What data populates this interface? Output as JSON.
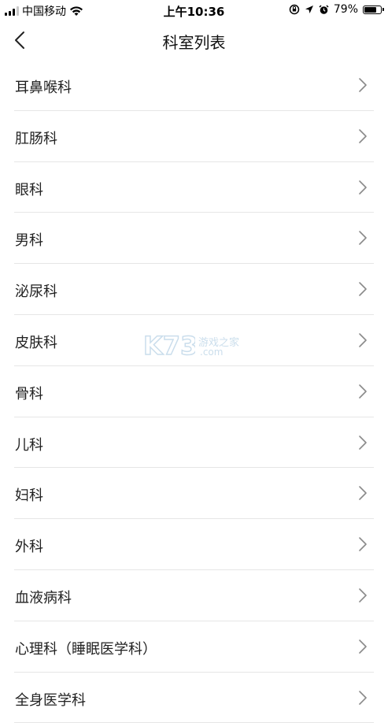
{
  "status_bar": {
    "carrier": "中国移动",
    "time": "上午10:36",
    "battery": "79%",
    "battery_level": 0.79,
    "icons": [
      "signal-icon",
      "wifi-icon",
      "lock-rotation-icon",
      "location-icon",
      "alarm-icon",
      "battery-icon"
    ]
  },
  "header": {
    "title": "科室列表",
    "back_icon": "back-arrow-icon"
  },
  "departments": [
    {
      "label": "耳鼻喉科"
    },
    {
      "label": "肛肠科"
    },
    {
      "label": "眼科"
    },
    {
      "label": "男科"
    },
    {
      "label": "泌尿科"
    },
    {
      "label": "皮肤科"
    },
    {
      "label": "骨科"
    },
    {
      "label": "儿科"
    },
    {
      "label": "妇科"
    },
    {
      "label": "外科"
    },
    {
      "label": "血液病科"
    },
    {
      "label": "心理科（睡眠医学科）"
    },
    {
      "label": "全身医学科"
    }
  ],
  "watermark": {
    "logo": "K73",
    "text": "游戏之家",
    "domain": ".com"
  },
  "colors": {
    "background": "#ffffff",
    "text": "#222222",
    "divider": "#e6e6e6",
    "chevron": "#8a8a8a"
  }
}
